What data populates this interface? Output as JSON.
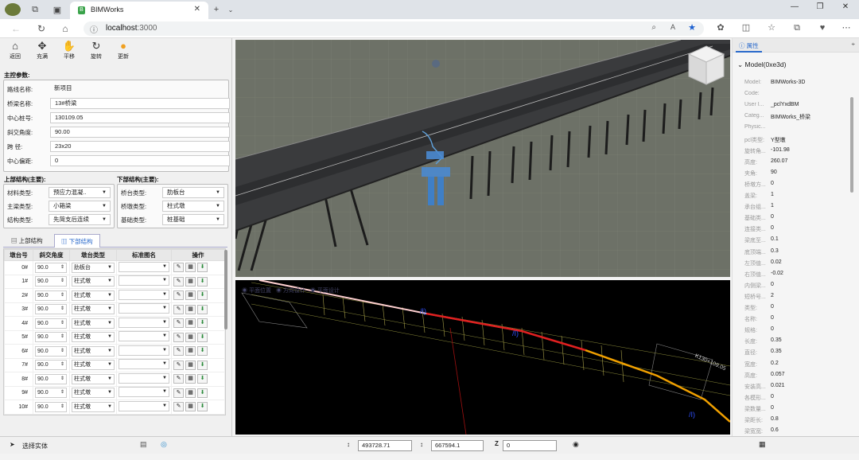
{
  "browser": {
    "tab_title": "BIMWorks",
    "url_host": "localhost",
    "url_port": ":3000"
  },
  "toolbar": [
    {
      "icon": "home-icon",
      "glyph": "⌂",
      "label": "返回"
    },
    {
      "icon": "move-icon",
      "glyph": "✥",
      "label": "充满"
    },
    {
      "icon": "hand-icon",
      "glyph": "✋",
      "label": "平移"
    },
    {
      "icon": "rotate-icon",
      "glyph": "↻",
      "label": "旋转"
    },
    {
      "icon": "refresh-icon",
      "glyph": "●",
      "label": "更新"
    }
  ],
  "main_params": {
    "title": "主控参数:",
    "fields": [
      {
        "label": "路线名称:",
        "value": "新项目"
      },
      {
        "label": "桥梁名称:",
        "value": "13#桥梁"
      },
      {
        "label": "中心桩号:",
        "value": "130109.05"
      },
      {
        "label": "斜交角度:",
        "value": "90.00"
      },
      {
        "label": "跨    径:",
        "value": "23x20"
      },
      {
        "label": "中心偏距:",
        "value": "0"
      }
    ]
  },
  "upper": {
    "title": "上部结构(主要):",
    "rows": [
      {
        "label": "材料类型:",
        "value": "预应力混凝.."
      },
      {
        "label": "主梁类型:",
        "value": "小箱梁"
      },
      {
        "label": "结构类型:",
        "value": "先简支后连续"
      }
    ]
  },
  "lower": {
    "title": "下部结构(主要):",
    "rows": [
      {
        "label": "桥台类型:",
        "value": "肋板台"
      },
      {
        "label": "桥墩类型:",
        "value": "柱式墩"
      },
      {
        "label": "基础类型:",
        "value": "桩基础"
      }
    ]
  },
  "tabs": [
    {
      "label": "上部结构",
      "icon": "grid-icon"
    },
    {
      "label": "下部结构",
      "icon": "chart-icon"
    }
  ],
  "table": {
    "headers": [
      "墩台号",
      "斜交角度",
      "墩台类型",
      "标准图名",
      "操作"
    ],
    "rows": [
      {
        "id": "0#",
        "angle": "90.0",
        "type": "肋板台"
      },
      {
        "id": "1#",
        "angle": "90.0",
        "type": "柱式墩"
      },
      {
        "id": "2#",
        "angle": "90.0",
        "type": "柱式墩"
      },
      {
        "id": "3#",
        "angle": "90.0",
        "type": "柱式墩"
      },
      {
        "id": "4#",
        "angle": "90.0",
        "type": "柱式墩"
      },
      {
        "id": "5#",
        "angle": "90.0",
        "type": "柱式墩"
      },
      {
        "id": "6#",
        "angle": "90.0",
        "type": "柱式墩"
      },
      {
        "id": "7#",
        "angle": "90.0",
        "type": "柱式墩"
      },
      {
        "id": "8#",
        "angle": "90.0",
        "type": "柱式墩"
      },
      {
        "id": "9#",
        "angle": "90.0",
        "type": "柱式墩"
      },
      {
        "id": "10#",
        "angle": "90.0",
        "type": "柱式墩"
      }
    ]
  },
  "view2d": {
    "radio_labels": [
      "平面位置",
      "方向设计",
      "平面设计"
    ],
    "station_label": "K130+109.05"
  },
  "props": {
    "tab_label": "属性",
    "header": "Model(0xe3d)",
    "rows": [
      {
        "k": "Model:",
        "v": "BIMWorks-3D"
      },
      {
        "k": "Code:",
        "v": ""
      },
      {
        "k": "User I...",
        "v": "_pclYxdBM"
      },
      {
        "k": "Categ...",
        "v": "BIMWorks_桥梁"
      },
      {
        "k": "Physic...",
        "v": ""
      },
      {
        "k": "pcl类型:",
        "v": "Y型墩"
      },
      {
        "k": "旋转角...",
        "v": "-101.98"
      },
      {
        "k": "高度:",
        "v": "260.07"
      },
      {
        "k": "夹角:",
        "v": "90"
      },
      {
        "k": "桥墩方...",
        "v": "0"
      },
      {
        "k": "盖梁:",
        "v": "1"
      },
      {
        "k": "承台组...",
        "v": "1"
      },
      {
        "k": "基础类...",
        "v": "0"
      },
      {
        "k": "连接类...",
        "v": "0"
      },
      {
        "k": "梁底至...",
        "v": "0.1"
      },
      {
        "k": "底顶端...",
        "v": "0.3"
      },
      {
        "k": "左顶值...",
        "v": "0.02"
      },
      {
        "k": "右顶值...",
        "v": "-0.02"
      },
      {
        "k": "内侧梁...",
        "v": "0"
      },
      {
        "k": "短桥号...",
        "v": "2"
      },
      {
        "k": "类型:",
        "v": "0"
      },
      {
        "k": "名称:",
        "v": "0"
      },
      {
        "k": "规格:",
        "v": "0"
      },
      {
        "k": "长度:",
        "v": "0.35"
      },
      {
        "k": "直径:",
        "v": "0.35"
      },
      {
        "k": "宽度:",
        "v": "0.2"
      },
      {
        "k": "高度:",
        "v": "0.057"
      },
      {
        "k": "安装高...",
        "v": "0.021"
      },
      {
        "k": "各模形...",
        "v": "0"
      },
      {
        "k": "梁数量...",
        "v": "0"
      },
      {
        "k": "梁距长:",
        "v": "0.8"
      },
      {
        "k": "梁宽宽:",
        "v": "0.6"
      }
    ]
  },
  "status": {
    "select_label": "选择实体",
    "x": "493728.71",
    "y": "667594.1",
    "z": "0"
  }
}
